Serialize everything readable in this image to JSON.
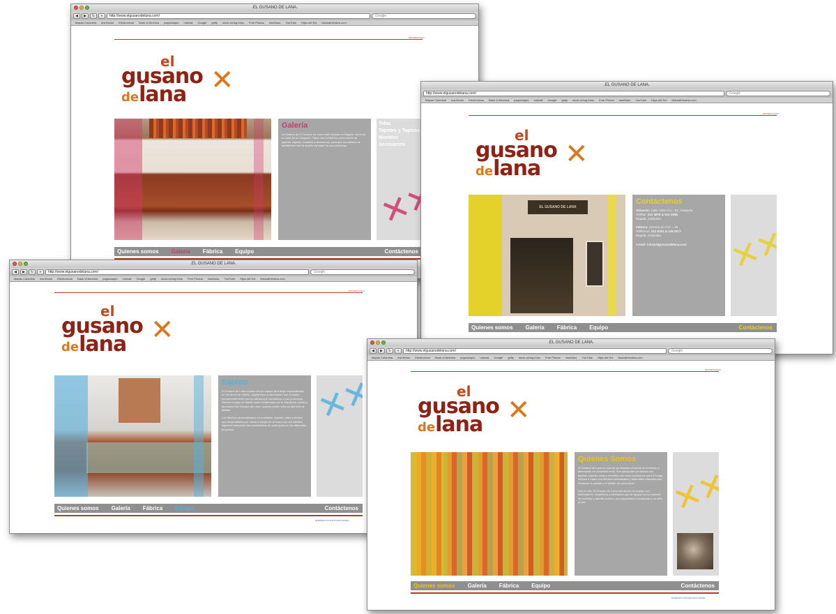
{
  "browser": {
    "window_title": ".EL GUSANO DE LANA.",
    "url": "http://www.elgusanodelana.com/",
    "search_placeholder": "Google",
    "bookmarks": [
      "Mapas Colombia",
      "msnHome",
      "Electronicos",
      "Bank of America",
      "pagosclaplo",
      "hotmail",
      "Google",
      "getty",
      "stock.xchng fotos",
      "Free Photos",
      "msnNoks",
      "YouTube",
      "Hijos del Sol",
      "NaturalHealers.com"
    ],
    "back": "◀",
    "forward": "▶",
    "reload": "↻",
    "add": "+"
  },
  "site": {
    "logo_el": "el",
    "logo_gusano": "gusano",
    "logo_de": "de",
    "logo_lana": "lana",
    "top_link": "ESTAMOS AQUI",
    "footer_credit": "DISEÑADO POR ESTUDIO MAREA",
    "menu": {
      "quienes": "Quienes somos",
      "galeria": "Galería",
      "fabrica": "Fábrica",
      "equipo": "Equipo",
      "contacto": "Contáctenos"
    }
  },
  "windows": {
    "galeria": {
      "panel_title": "Galería",
      "panel_text": "La Galería de El Gusano de Lana está ubicada en Bogotá, cerca de la Calle 84 de Usaquén. Tiene una exhibición permanente de tapetes, tapices, muebles y accesorios, para que los clientes se familiaricen con la amplia variedad de sus productos.",
      "side_items": [
        "Telas",
        "Tapetes y Tapices",
        "Muebles",
        "Accesorios"
      ]
    },
    "contacto": {
      "panel_title": "Contáctenos",
      "address_label": "Almacén:",
      "address": "Calle 120A # 6 – 01, Usaquén",
      "phone_label": "Teléfax:",
      "phone": "212 3876 & 612 4085",
      "city": "Bogotá, Colombia",
      "factory_label": "Fábrica:",
      "factory": "Carrera 21 # 57 – 29",
      "factory_phone_label": "Teléfonos:",
      "factory_phone": "212 6191 & 249 0577",
      "factory_city": "Bogotá, Colombia",
      "email_label": "e-mail:",
      "email": "info@elgusanodelana.com",
      "sign_text": "EL GUSANO DE LANA"
    },
    "equipo": {
      "panel_title": "Equipo",
      "panel_text": "El Gusano de Lana cuenta con un equipo de trabajo especializado en las áreas de diseño, arquitectura y decoración que cumplen permanentemente con la calidad que caracteriza a sus productos. Nuestro equipo de diseño está encabezado por el Arquitecto, pintor y decorador del Gusano de Lana, quienes ponen toda su atención al detalle.",
      "panel_text2": "Los diseños personalizados en mobiliario, tapetes, telas y textiles son desarrollados por nuestro equipo de la mano con los clientes, logrando interpretar las necesidades de cada quien en los diferentes proyectos."
    },
    "quienes": {
      "panel_title": "Quienes Somos",
      "panel_text": "El Gusano de Lana es una de las fábricas pioneras en el diseño y fabricación de mobiliario textil. Sus principales productos son tapetes, tapices, telas y muebles, así como accesorios para el hogar, hechos a mano con técnicas artesanales y materiales naturales que destacan la calidad y el detalle de cada pieza.",
      "panel_text2": "Hoy en día, El Gusano de Lana cuenta con un equipo con diseñadores, arquitectos y artesanos que se apoyan en la creación de muebles y tapetes únicos, con propuestas innovadoras y un sello propio."
    }
  },
  "colors": {
    "brand_red": "#8e2214",
    "brand_orange": "#e0761b",
    "panel_grey": "#a7a7a7",
    "menu_grey": "#8f8f8f",
    "accent_galeria": "#d2376b",
    "accent_contacto": "#e8d028",
    "accent_equipo": "#56b1de",
    "accent_quienes": "#f0c21c"
  }
}
